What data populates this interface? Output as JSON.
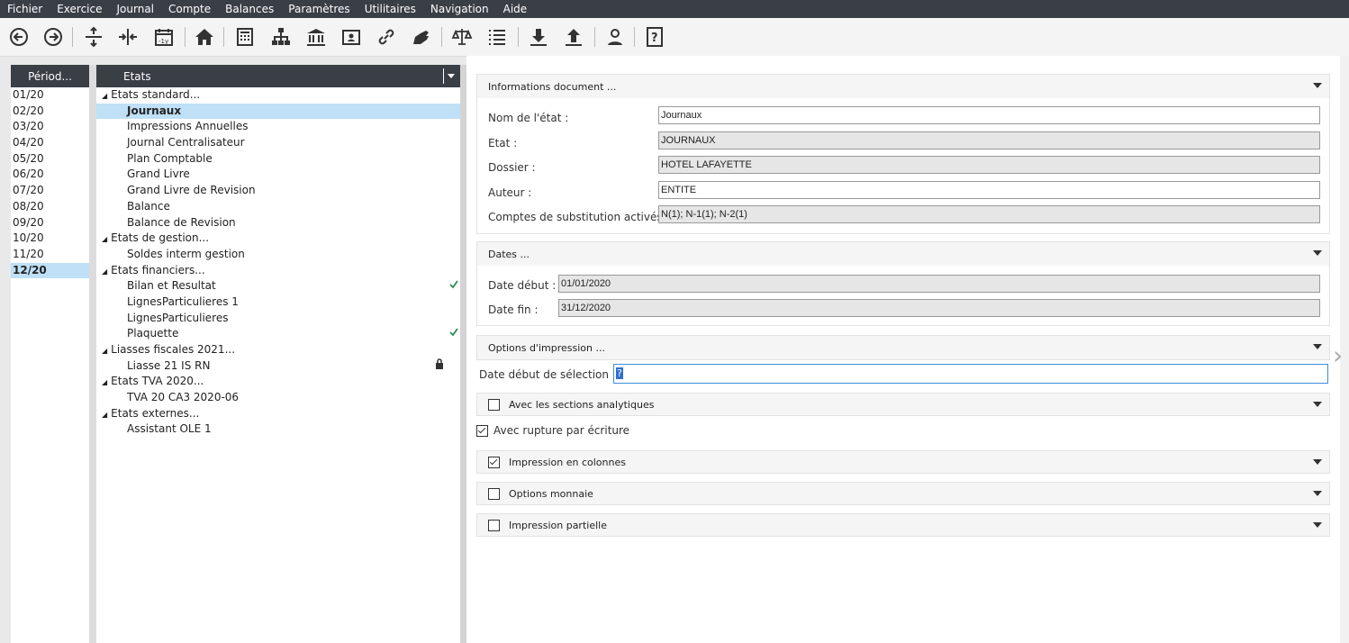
{
  "menu": [
    "Fichier",
    "Exercice",
    "Journal",
    "Compte",
    "Balances",
    "Paramètres",
    "Utilitaires",
    "Navigation",
    "Aide"
  ],
  "toolbar_icons": [
    "back-icon",
    "forward-icon",
    "expand-vertical-icon",
    "collapse-horizontal-icon",
    "calendar-minus-year-icon",
    "home-icon",
    "calculator-icon",
    "org-chart-icon",
    "bank-icon",
    "contact-card-icon",
    "link-icon",
    "hand-icon",
    "balance-scale-icon",
    "list-icon",
    "download-icon",
    "upload-icon",
    "user-icon",
    "help-icon"
  ],
  "periods": {
    "header": "Périod...",
    "items": [
      "01/20",
      "02/20",
      "03/20",
      "04/20",
      "05/20",
      "06/20",
      "07/20",
      "08/20",
      "09/20",
      "10/20",
      "11/20",
      "12/20"
    ],
    "selected": "12/20"
  },
  "states": {
    "header": "Etats",
    "rows": [
      {
        "type": "group",
        "label": "Etats standard..."
      },
      {
        "type": "item",
        "label": "Journaux",
        "selected": true
      },
      {
        "type": "item",
        "label": "Impressions Annuelles"
      },
      {
        "type": "item",
        "label": "Journal Centralisateur"
      },
      {
        "type": "item",
        "label": "Plan Comptable"
      },
      {
        "type": "item",
        "label": "Grand Livre"
      },
      {
        "type": "item",
        "label": "Grand Livre de Revision"
      },
      {
        "type": "item",
        "label": "Balance"
      },
      {
        "type": "item",
        "label": "Balance de Revision"
      },
      {
        "type": "group",
        "label": "Etats de gestion..."
      },
      {
        "type": "item",
        "label": "Soldes interm gestion"
      },
      {
        "type": "group",
        "label": "Etats financiers..."
      },
      {
        "type": "item",
        "label": "Bilan et Resultat",
        "mark": "check"
      },
      {
        "type": "item",
        "label": "LignesParticulieres 1"
      },
      {
        "type": "item",
        "label": "LignesParticulieres"
      },
      {
        "type": "item",
        "label": "Plaquette",
        "mark": "check"
      },
      {
        "type": "group",
        "label": "Liasses fiscales 2021..."
      },
      {
        "type": "item",
        "label": "Liasse 21 IS RN",
        "mark": "lock"
      },
      {
        "type": "group",
        "label": "Etats TVA 2020..."
      },
      {
        "type": "item",
        "label": "TVA 20 CA3 2020-06"
      },
      {
        "type": "group",
        "label": "Etats externes..."
      },
      {
        "type": "item",
        "label": "Assistant OLE 1"
      }
    ]
  },
  "info": {
    "title": "Informations document ...",
    "nom_label": "Nom de l'état :",
    "nom_value": "Journaux",
    "etat_label": "Etat :",
    "etat_value": "JOURNAUX",
    "dossier_label": "Dossier :",
    "dossier_value": "HOTEL LAFAYETTE",
    "auteur_label": "Auteur :",
    "auteur_value": "ENTITE",
    "comptes_label": "Comptes de substitution activés",
    "comptes_value": "N(1);  N-1(1);  N-2(1)"
  },
  "dates": {
    "title": "Dates ...",
    "debut_label": "Date début :",
    "debut_value": "01/01/2020",
    "fin_label": "Date fin :",
    "fin_value": "31/12/2020"
  },
  "options": {
    "title": "Options d'impression ...",
    "sel_label": "Date début de sélection :",
    "sel_value": "?",
    "sections_label": "Avec les sections analytiques",
    "sections_checked": false,
    "rupture_label": "Avec rupture par écriture",
    "rupture_checked": true,
    "colonnes_label": "Impression en colonnes",
    "colonnes_checked": true,
    "monnaie_label": "Options monnaie",
    "monnaie_checked": false,
    "partielle_label": "Impression partielle",
    "partielle_checked": false
  },
  "colors": {
    "menubar": "#3a3e45",
    "selection": "#bfe0f7",
    "check": "#2e8b57"
  }
}
